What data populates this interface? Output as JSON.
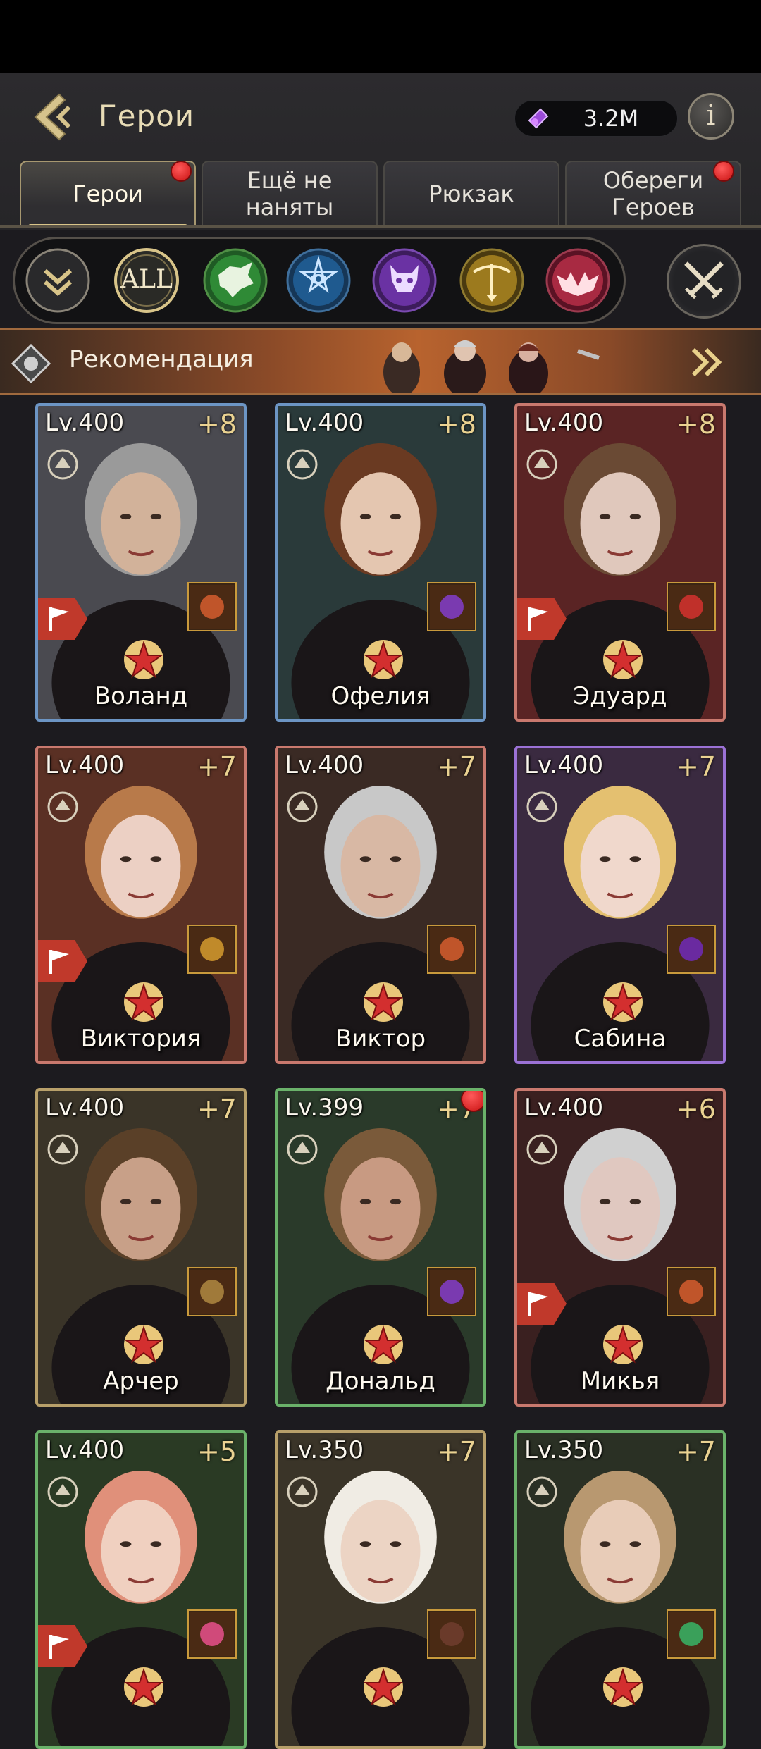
{
  "header": {
    "title": "Герои",
    "currency_value": "3.2M"
  },
  "tabs": [
    {
      "label": "Герои",
      "active": true,
      "notification": true
    },
    {
      "label": "Ещё не наняты",
      "active": false,
      "notification": false
    },
    {
      "label": "Рюкзак",
      "active": false,
      "notification": false
    },
    {
      "label": "Обереги\nГероев",
      "active": false,
      "notification": true
    }
  ],
  "filters": {
    "all_label": "ALL",
    "items": [
      "collapse",
      "all",
      "wolf",
      "eye-star",
      "demon",
      "crossbow",
      "bat"
    ]
  },
  "banner": {
    "label": "Рекомендация"
  },
  "heroes": [
    {
      "name": "Воланд",
      "level": "Lv.400",
      "plus": "+8",
      "frame": "blue",
      "flag": true,
      "notify": false
    },
    {
      "name": "Офелия",
      "level": "Lv.400",
      "plus": "+8",
      "frame": "blue",
      "flag": false,
      "notify": false
    },
    {
      "name": "Эдуард",
      "level": "Lv.400",
      "plus": "+8",
      "frame": "red",
      "flag": true,
      "notify": false
    },
    {
      "name": "Виктория",
      "level": "Lv.400",
      "plus": "+7",
      "frame": "red",
      "flag": true,
      "notify": false
    },
    {
      "name": "Виктор",
      "level": "Lv.400",
      "plus": "+7",
      "frame": "red",
      "flag": false,
      "notify": false
    },
    {
      "name": "Сабина",
      "level": "Lv.400",
      "plus": "+7",
      "frame": "purple",
      "flag": false,
      "notify": false
    },
    {
      "name": "Арчер",
      "level": "Lv.400",
      "plus": "+7",
      "frame": "gold",
      "flag": false,
      "notify": false
    },
    {
      "name": "Дональд",
      "level": "Lv.399",
      "plus": "+7",
      "frame": "green",
      "flag": false,
      "notify": true
    },
    {
      "name": "Микья",
      "level": "Lv.400",
      "plus": "+6",
      "frame": "red",
      "flag": true,
      "notify": false
    },
    {
      "name": "",
      "level": "Lv.400",
      "plus": "+5",
      "frame": "green",
      "flag": true,
      "notify": false
    },
    {
      "name": "",
      "level": "Lv.350",
      "plus": "+7",
      "frame": "gold",
      "flag": false,
      "notify": false
    },
    {
      "name": "",
      "level": "Lv.350",
      "plus": "+7",
      "frame": "green",
      "flag": false,
      "notify": false
    }
  ],
  "colors": {
    "frame_blue": "#6c95c4",
    "frame_red": "#c9796e",
    "frame_purple": "#9b72d6",
    "frame_gold": "#b8a06a",
    "frame_green": "#6ab26a",
    "accent_gold": "#d8c489",
    "notify_red": "#e02020"
  }
}
